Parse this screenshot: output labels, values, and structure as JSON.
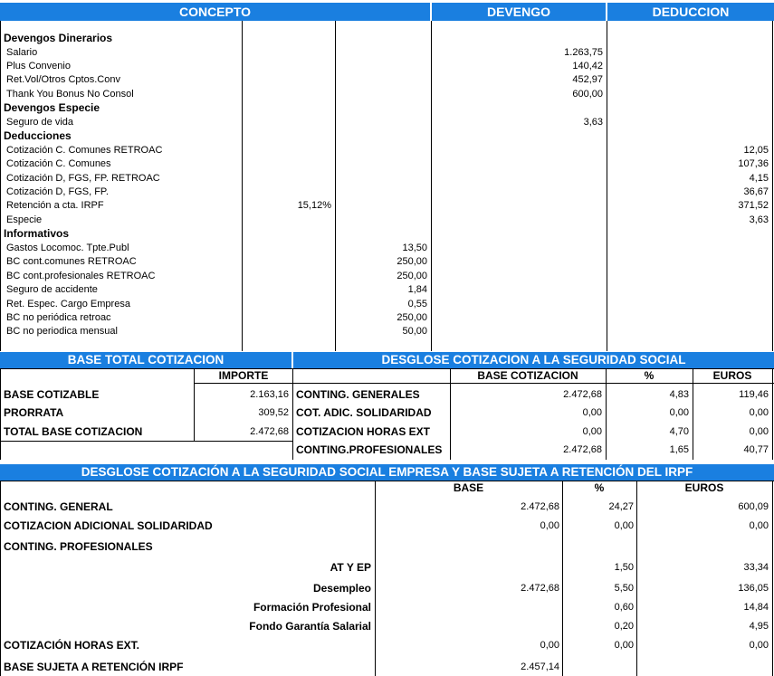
{
  "header": {
    "concepto": "CONCEPTO",
    "devengo": "DEVENGO",
    "deduccion": "DEDUCCION"
  },
  "concepts": [
    {
      "label": "Devengos Dinerarios",
      "section": true
    },
    {
      "label": "Salario",
      "devengo": "1.263,75"
    },
    {
      "label": "Plus Convenio",
      "devengo": "140,42"
    },
    {
      "label": "Ret.Vol/Otros Cptos.Conv",
      "devengo": "452,97"
    },
    {
      "label": "Thank You Bonus No Consol",
      "devengo": "600,00"
    },
    {
      "label": "Devengos Especie",
      "section": true
    },
    {
      "label": "Seguro de vida",
      "devengo": "3,63"
    },
    {
      "label": "Deducciones",
      "section": true
    },
    {
      "label": "Cotización C. Comunes RETROAC",
      "deduccion": "12,05"
    },
    {
      "label": "Cotización C. Comunes",
      "deduccion": "107,36"
    },
    {
      "label": "Cotización D, FGS, FP. RETROAC",
      "deduccion": "4,15"
    },
    {
      "label": "Cotización D, FGS, FP.",
      "deduccion": "36,67"
    },
    {
      "label": "Retención a cta. IRPF",
      "pct": "15,12%",
      "deduccion": "371,52"
    },
    {
      "label": "Especie",
      "deduccion": "3,63"
    },
    {
      "label": "Informativos",
      "section": true
    },
    {
      "label": "Gastos Locomoc. Tpte.Publ",
      "info": "13,50"
    },
    {
      "label": "BC cont.comunes RETROAC",
      "info": "250,00"
    },
    {
      "label": "BC cont.profesionales RETROAC",
      "info": "250,00"
    },
    {
      "label": "Seguro de accidente",
      "info": "1,84"
    },
    {
      "label": "Ret. Espec. Cargo Empresa",
      "info": "0,55"
    },
    {
      "label": "BC no periódica retroac",
      "info": "250,00"
    },
    {
      "label": "BC no periodica mensual",
      "info": "50,00"
    }
  ],
  "base_total": {
    "title": "BASE TOTAL COTIZACION",
    "importe_header": "IMPORTE",
    "rows": [
      {
        "label": "BASE COTIZABLE",
        "value": "2.163,16"
      },
      {
        "label": "PRORRATA",
        "value": "309,52"
      },
      {
        "label": "TOTAL BASE COTIZACION",
        "value": "2.472,68"
      }
    ]
  },
  "desglose": {
    "title": "DESGLOSE COTIZACION A LA SEGURIDAD SOCIAL",
    "col_base": "BASE COTIZACION",
    "col_pct": "%",
    "col_euros": "EUROS",
    "rows": [
      {
        "label": "CONTING. GENERALES",
        "base": "2.472,68",
        "pct": "4,83",
        "euros": "119,46"
      },
      {
        "label": "COT. ADIC. SOLIDARIDAD",
        "base": "0,00",
        "pct": "0,00",
        "euros": "0,00"
      },
      {
        "label": "COTIZACION HORAS EXT",
        "base": "0,00",
        "pct": "4,70",
        "euros": "0,00"
      },
      {
        "label": "CONTING.PROFESIONALES",
        "base": "2.472,68",
        "pct": "1,65",
        "euros": "40,77"
      }
    ]
  },
  "empresa": {
    "title": "DESGLOSE COTIZACIÓN A LA SEGURIDAD SOCIAL EMPRESA Y BASE SUJETA A RETENCIÓN DEL IRPF",
    "col_base": "BASE",
    "col_pct": "%",
    "col_euros": "EUROS",
    "rows": [
      {
        "label": "CONTING. GENERAL",
        "base": "2.472,68",
        "pct": "24,27",
        "euros": "600,09"
      },
      {
        "label": "COTIZACION ADICIONAL SOLIDARIDAD",
        "base": "0,00",
        "pct": "0,00",
        "euros": "0,00"
      },
      {
        "label": "CONTING. PROFESIONALES"
      },
      {
        "sub": "AT Y EP",
        "pct": "1,50",
        "euros": "33,34"
      },
      {
        "sub": "Desempleo",
        "base": "2.472,68",
        "pct": "5,50",
        "euros": "136,05"
      },
      {
        "sub": "Formación Profesional",
        "pct": "0,60",
        "euros": "14,84"
      },
      {
        "sub": "Fondo Garantía Salarial",
        "pct": "0,20",
        "euros": "4,95"
      },
      {
        "label": "COTIZACIÓN HORAS EXT.",
        "base": "0,00",
        "pct": "0,00",
        "euros": "0,00"
      },
      {
        "label": "BASE SUJETA A RETENCIÓN IRPF",
        "base": "2.457,14"
      }
    ]
  },
  "colors": {
    "header_bg": "#1a7fe0",
    "header_text": "#ffffff"
  }
}
